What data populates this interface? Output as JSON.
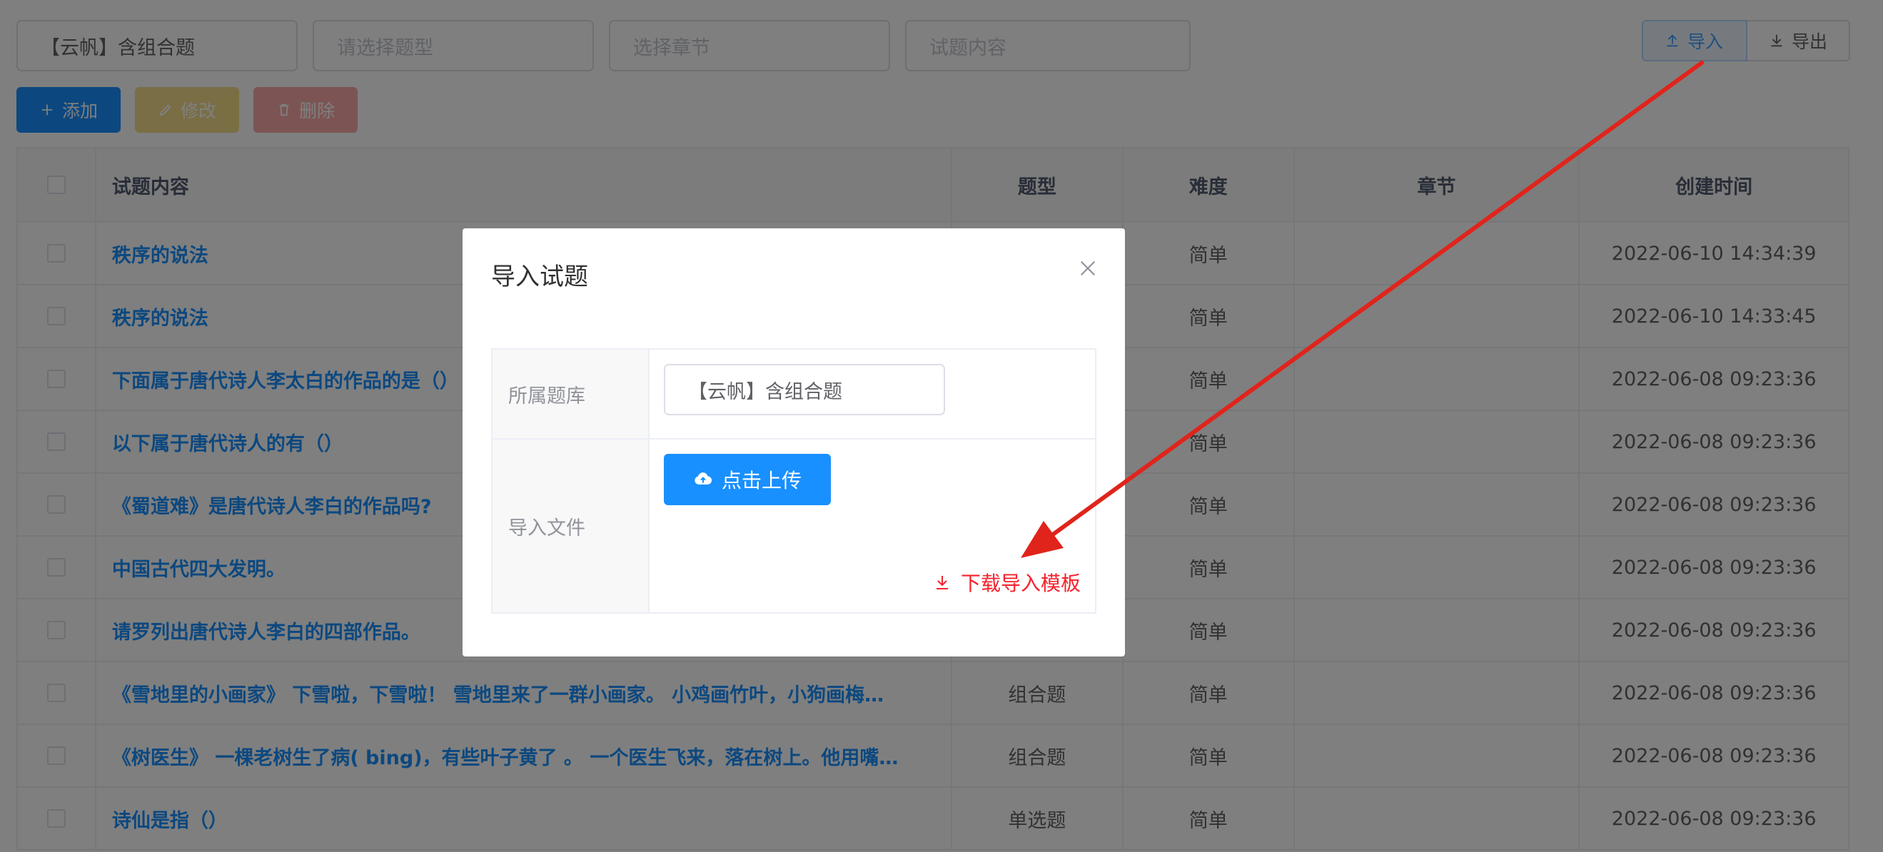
{
  "filters": {
    "bank_value": "【云帆】含组合题",
    "type_placeholder": "请选择题型",
    "chapter_placeholder": "选择章节",
    "content_placeholder": "试题内容"
  },
  "io": {
    "import_label": "导入",
    "export_label": "导出"
  },
  "actions": {
    "add_label": "添加",
    "edit_label": "修改",
    "delete_label": "删除"
  },
  "table": {
    "headers": {
      "content": "试题内容",
      "type": "题型",
      "difficulty": "难度",
      "chapter": "章节",
      "created": "创建时间"
    },
    "rows": [
      {
        "content": "秩序的说法",
        "type": "",
        "difficulty": "简单",
        "chapter": "",
        "created": "2022-06-10 14:34:39"
      },
      {
        "content": "秩序的说法",
        "type": "",
        "difficulty": "简单",
        "chapter": "",
        "created": "2022-06-10 14:33:45"
      },
      {
        "content": "下面属于唐代诗人李太白的作品的是（）",
        "type": "",
        "difficulty": "简单",
        "chapter": "",
        "created": "2022-06-08 09:23:36"
      },
      {
        "content": "以下属于唐代诗人的有（）",
        "type": "",
        "difficulty": "简单",
        "chapter": "",
        "created": "2022-06-08 09:23:36"
      },
      {
        "content": "《蜀道难》是唐代诗人李白的作品吗?",
        "type": "",
        "difficulty": "简单",
        "chapter": "",
        "created": "2022-06-08 09:23:36"
      },
      {
        "content": "中国古代四大发明。",
        "type": "",
        "difficulty": "简单",
        "chapter": "",
        "created": "2022-06-08 09:23:36"
      },
      {
        "content": "请罗列出唐代诗人李白的四部作品。",
        "type": "",
        "difficulty": "简单",
        "chapter": "",
        "created": "2022-06-08 09:23:36"
      },
      {
        "content": "《雪地里的小画家》 下雪啦，下雪啦！ 雪地里来了一群小画家。 小鸡画竹叶，小狗画梅…",
        "type": "组合题",
        "difficulty": "简单",
        "chapter": "",
        "created": "2022-06-08 09:23:36"
      },
      {
        "content": "《树医生》 一棵老树生了病( bing)，有些叶子黄了 。 一个医生飞来，落在树上。他用嘴…",
        "type": "组合题",
        "difficulty": "简单",
        "chapter": "",
        "created": "2022-06-08 09:23:36"
      },
      {
        "content": "诗仙是指（）",
        "type": "单选题",
        "difficulty": "简单",
        "chapter": "",
        "created": "2022-06-08 09:23:36"
      }
    ]
  },
  "dialog": {
    "title": "导入试题",
    "bank_label": "所属题库",
    "bank_value": "【云帆】含组合题",
    "file_label": "导入文件",
    "upload_label": "点击上传",
    "download_label": "下载导入模板"
  },
  "colors": {
    "primary": "#1890ff",
    "danger": "#f5222d",
    "annotation": "#e0241b"
  }
}
